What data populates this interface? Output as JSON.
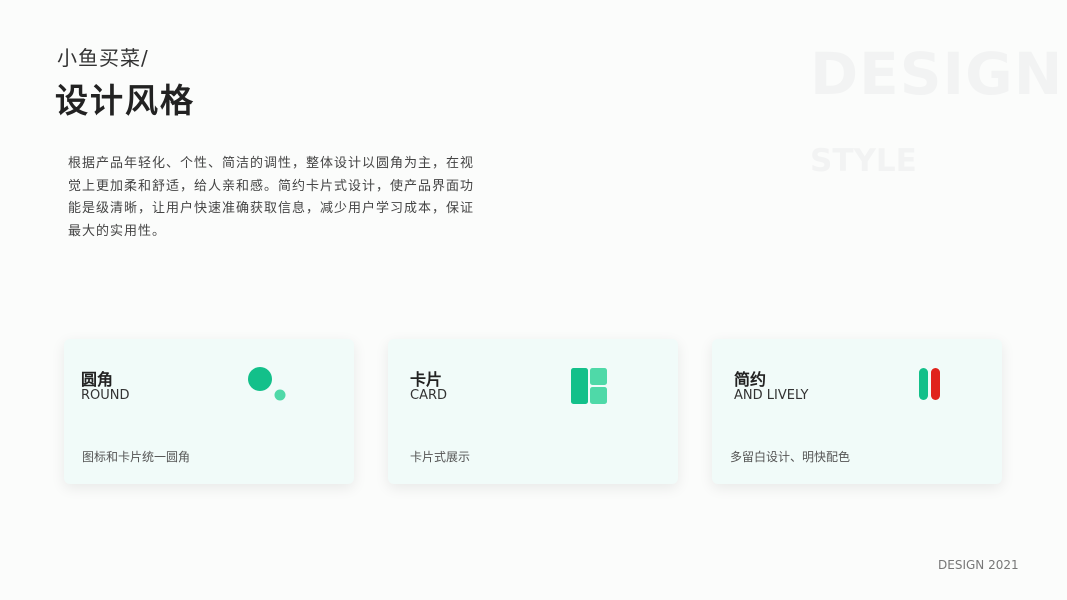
{
  "header": {
    "subtitle": "小鱼买菜/",
    "title": "设计风格"
  },
  "watermark": {
    "big": "DESIGN",
    "small": "STYLE"
  },
  "description": "根据产品年轻化、个性、简洁的调性，整体设计以圆角为主，在视觉上更加柔和舒适，给人亲和感。简约卡片式设计，使产品界面功能是级清晰，让用户快速准确获取信息，减少用户学习成本，保证最大的实用性。",
  "cards": [
    {
      "title": "圆角",
      "en": "ROUND",
      "desc": "图标和卡片统一圆角",
      "icon": "circles-icon"
    },
    {
      "title": "卡片",
      "en": "CARD",
      "desc": "卡片式展示",
      "icon": "card-layout-icon"
    },
    {
      "title": "简约",
      "en": "AND LIVELY",
      "desc": "多留白设计、明快配色",
      "icon": "pills-icon"
    }
  ],
  "colors": {
    "accent_green": "#13c08a",
    "light_green": "#4fd9a8",
    "accent_red": "#e0231c",
    "card_bg": "#f1fbf9"
  },
  "footer": "DESIGN 2021"
}
